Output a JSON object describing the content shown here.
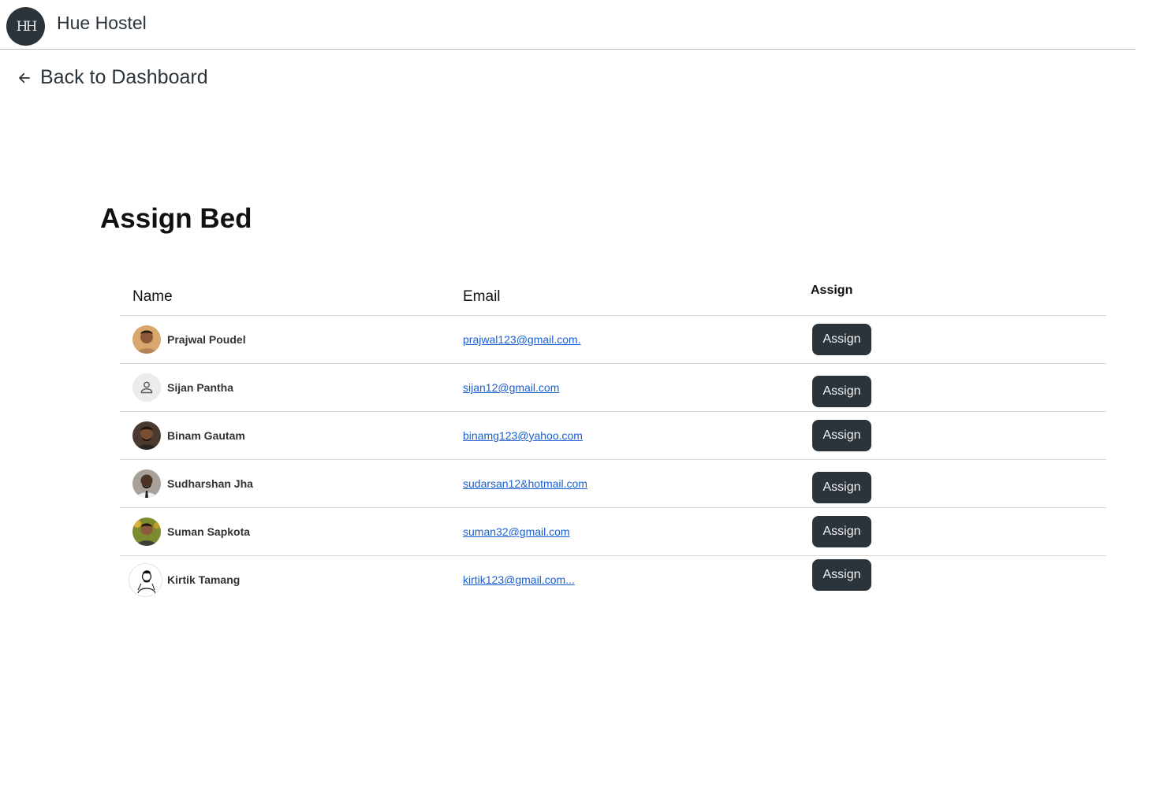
{
  "header": {
    "logo_text": "HH",
    "brand": "Hue Hostel"
  },
  "nav": {
    "back_label": "Back to Dashboard"
  },
  "page": {
    "title": "Assign Bed"
  },
  "table": {
    "columns": [
      "Name",
      "Email",
      "Assign"
    ],
    "rows": [
      {
        "name": "Prajwal Poudel",
        "email": "prajwal123@gmail.com.",
        "action": "Assign",
        "avatar": "photo-avatar"
      },
      {
        "name": "Sijan Pantha",
        "email": "sijan12@gmail.com",
        "action": "Assign",
        "avatar": "person-icon"
      },
      {
        "name": "Binam Gautam",
        "email": "binamg123@yahoo.com",
        "action": "Assign",
        "avatar": "photo-avatar"
      },
      {
        "name": "Sudharshan Jha",
        "email": "sudarsan12&hotmail.com",
        "action": "Assign",
        "avatar": "photo-avatar"
      },
      {
        "name": "Suman Sapkota",
        "email": "suman32@gmail.com",
        "action": "Assign",
        "avatar": "photo-avatar"
      },
      {
        "name": "Kirtik Tamang",
        "email": "kirtik123@gmail.com...",
        "action": "Assign",
        "avatar": "sketch-avatar"
      }
    ]
  },
  "colors": {
    "primary": "#2b343b",
    "link": "#1a5fd0",
    "divider": "#d6d6d6"
  }
}
